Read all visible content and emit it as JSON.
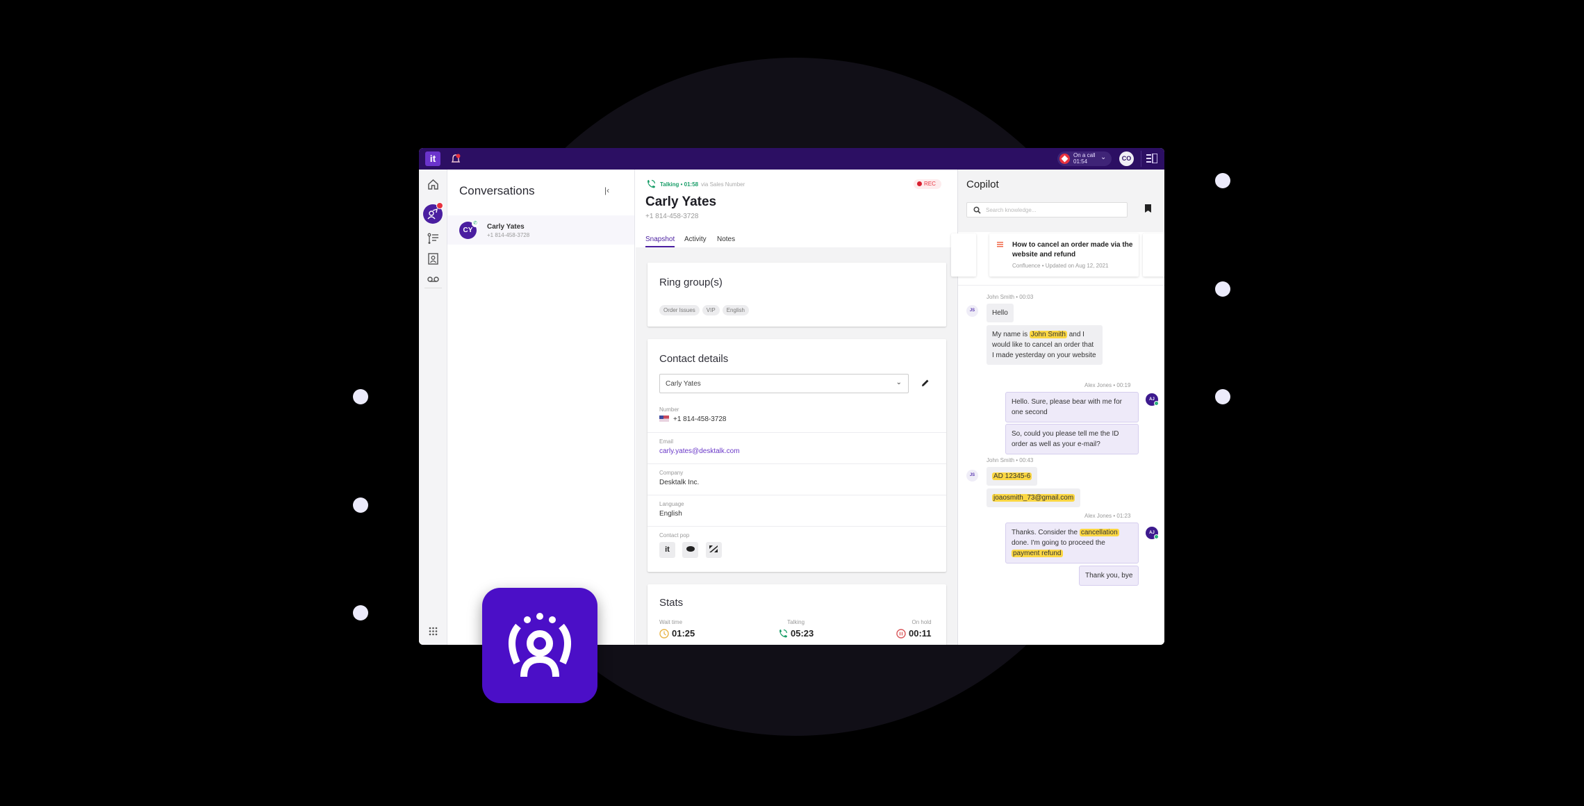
{
  "topbar": {
    "logo": "it",
    "call_status_label": "On a call",
    "call_status_time": "01:54",
    "user_initials": "CO"
  },
  "rail": {
    "items": [
      "home",
      "conversations",
      "queue",
      "contacts",
      "voicemail",
      "apps"
    ]
  },
  "conversations": {
    "title": "Conversations",
    "items": [
      {
        "initials": "CY",
        "name": "Carly Yates",
        "phone": "+1 814-458-3728"
      }
    ]
  },
  "call": {
    "status": "Talking • 01:58",
    "via": "via Sales Number",
    "rec_label": "REC",
    "contact_name": "Carly Yates",
    "contact_phone": "+1 814-458-3728",
    "tabs": [
      "Snapshot",
      "Activity",
      "Notes"
    ],
    "active_tab": "Snapshot"
  },
  "ring_groups": {
    "title": "Ring group(s)",
    "chips": [
      "Order Issues",
      "VIP",
      "English"
    ]
  },
  "contact_details": {
    "title": "Contact details",
    "selected_contact": "Carly Yates",
    "fields": [
      {
        "label": "Number",
        "value": "+1 814-458-3728"
      },
      {
        "label": "Email",
        "value": "carly.yates@desktalk.com"
      },
      {
        "label": "Company",
        "value": "Desktalk Inc."
      },
      {
        "label": "Language",
        "value": "English"
      },
      {
        "label": "Contact pop",
        "value": ""
      }
    ],
    "contact_pop_apps": [
      "it",
      "salesforce",
      "zendesk"
    ]
  },
  "stats": {
    "title": "Stats",
    "items": [
      {
        "label": "Wait time",
        "value": "01:25"
      },
      {
        "label": "Talking",
        "value": "05:23"
      },
      {
        "label": "On hold",
        "value": "00:11"
      }
    ]
  },
  "copilot": {
    "title": "Copilot",
    "search_placeholder": "Search knowledge...",
    "kb_card": {
      "title": "How to cancel an order made via the website and refund",
      "meta": "Confluence • Updated on Aug 12, 2021"
    },
    "messages": [
      {
        "meta": "John Smith • 00:03",
        "initials": "JS"
      },
      {
        "text": "Hello"
      },
      {
        "pre": "My name is ",
        "hl": "John Smith",
        "post": " and I would like to cancel an order that I made yesterday on your website"
      },
      {
        "meta": "Alex Jones • 00:19",
        "initials": "AJ"
      },
      {
        "text": "Hello. Sure, please bear with me for one second"
      },
      {
        "text": "So, could you please tell me the ID order as well as your e-mail?"
      },
      {
        "meta": "John Smith • 00:43",
        "initials": "JS"
      },
      {
        "hl": "AD 12345-6"
      },
      {
        "hl": "joaosmith_73@gmail.com"
      },
      {
        "meta": "Alex Jones • 01:23",
        "initials": "AJ"
      },
      {
        "pre": "Thanks. Consider the ",
        "hl": "cancellation",
        "mid": " done. I'm going to proceed the ",
        "hl2": "payment refund"
      },
      {
        "text": "Thank you, bye"
      }
    ]
  },
  "colors": {
    "brand_dark": "#2c0f63",
    "brand": "#4a1ea0",
    "talking_green": "#1a9e69",
    "rec_red": "#e8323e",
    "highlight": "#fbd743",
    "app_tile": "#4b0fc7"
  }
}
